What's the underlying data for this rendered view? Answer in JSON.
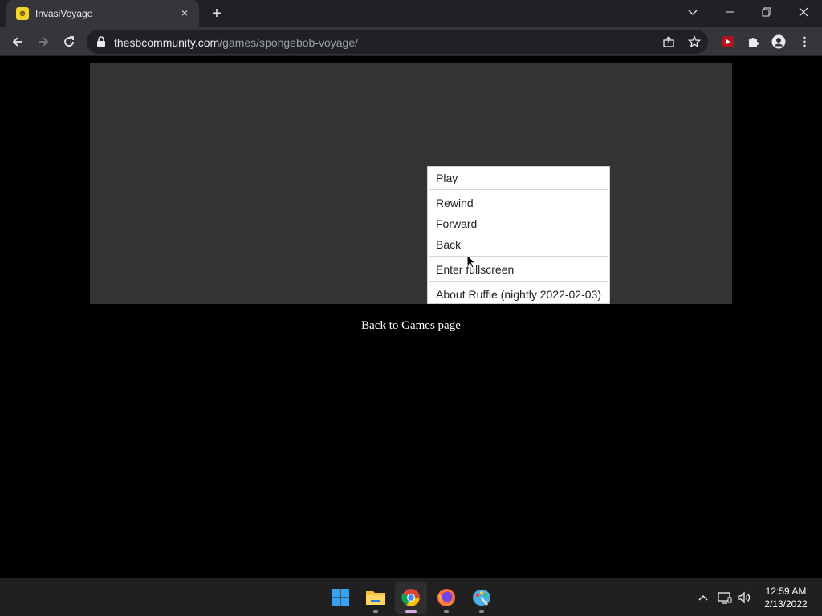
{
  "browser": {
    "tab": {
      "title": "InvasiVoyage",
      "favicon": "spongebob-favicon-icon",
      "close": "×"
    },
    "new_tab": "+",
    "window_controls": [
      "tab-search-icon",
      "minimize-icon",
      "restore-icon",
      "close-icon"
    ],
    "url": {
      "host": "thesbcommunity.com",
      "path": "/games/spongebob-voyage/"
    },
    "toolbar_icons": [
      "back-icon",
      "forward-icon",
      "reload-icon",
      "lock-icon",
      "share-icon",
      "star-icon",
      "extension-red-icon",
      "puzzle-icon",
      "profile-icon",
      "kebab-menu-icon"
    ]
  },
  "page": {
    "player_bg": "#333333",
    "context_menu": {
      "items": [
        "Play",
        "Rewind",
        "Forward",
        "Back",
        "Enter fullscreen",
        "About Ruffle (nightly 2022-02-03)"
      ]
    },
    "back_link": "Back to Games page"
  },
  "taskbar": {
    "apps": [
      "windows-start-icon",
      "file-explorer-icon",
      "chrome-icon",
      "firefox-icon",
      "paint-icon"
    ],
    "active_app": "chrome-icon",
    "tray": [
      "chevron-up-icon",
      "network-icon",
      "volume-icon"
    ],
    "time": "12:59 AM",
    "date": "2/13/2022"
  }
}
